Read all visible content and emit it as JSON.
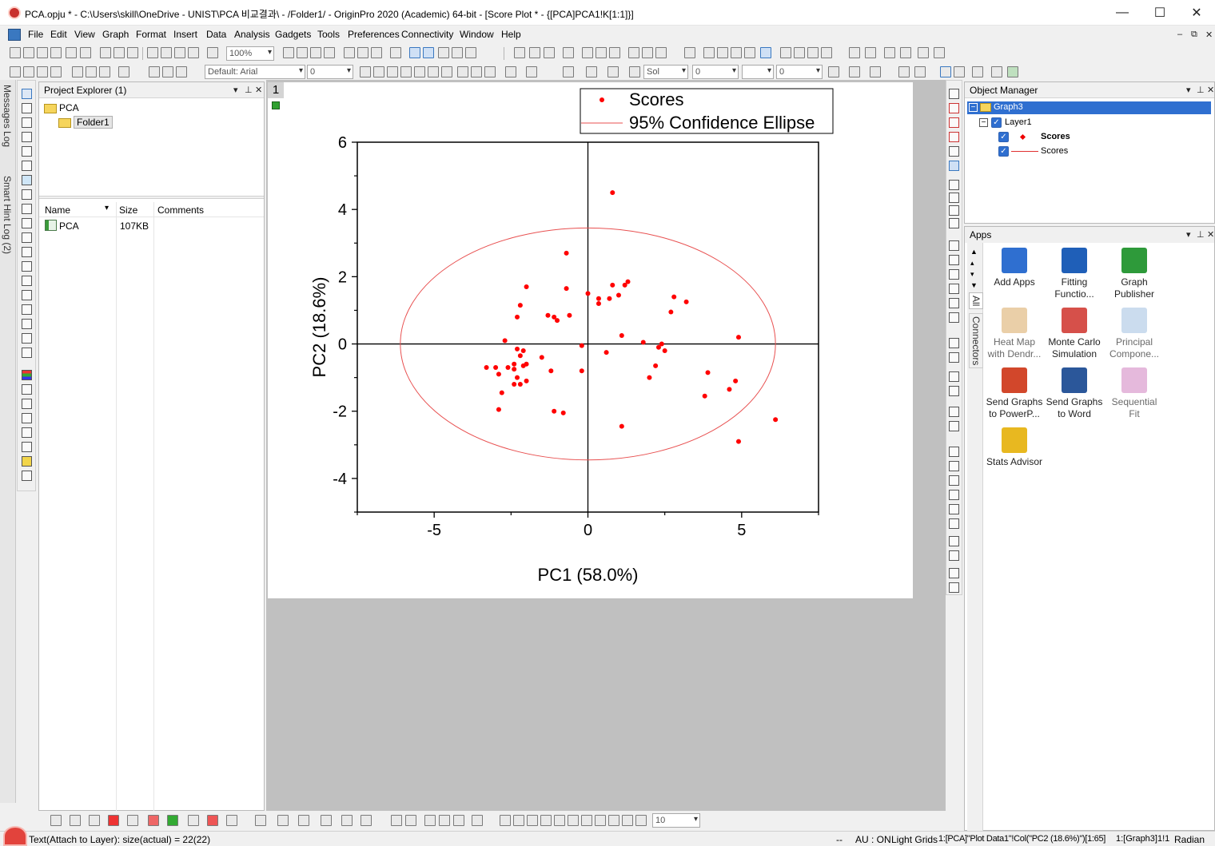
{
  "window": {
    "title": "PCA.opju * - C:\\Users\\skill\\OneDrive - UNIST\\PCA 비교결과\\ - /Folder1/ - OriginPro 2020 (Academic) 64-bit - [Score Plot * - {[PCA]PCA1!K[1:1]}]",
    "minimize": "—",
    "maximize": "☐",
    "close": "✕"
  },
  "menu": {
    "items": [
      "File",
      "Edit",
      "View",
      "Graph",
      "Format",
      "Insert",
      "Data",
      "Analysis",
      "Gadgets",
      "Tools",
      "Preferences",
      "Connectivity",
      "Window",
      "Help"
    ],
    "mdi_min": "–",
    "mdi_restore": "⧉",
    "mdi_close": "✕"
  },
  "toolbar": {
    "zoom": "100%",
    "font": "Default: Arial",
    "font_size": "0",
    "line_style": "Sol",
    "line_width": "0",
    "color_value": "0",
    "bottom_size": "10"
  },
  "side_tabs": {
    "messages_log": "Messages Log",
    "smart_hint_log": "Smart Hint Log (2)"
  },
  "project_explorer": {
    "title": "Project Explorer (1)",
    "root": "PCA",
    "folder": "Folder1",
    "columns": [
      "Name",
      "Size",
      "Comments"
    ],
    "files": [
      {
        "name": "PCA",
        "size": "107KB",
        "comments": ""
      }
    ]
  },
  "graph": {
    "layer_number": "1",
    "legend": [
      "Scores",
      "95% Confidence Ellipse"
    ]
  },
  "chart_data": {
    "type": "scatter",
    "title": "",
    "xlabel": "PC1 (58.0%)",
    "ylabel": "PC2 (18.6%)",
    "xlim": [
      -7.5,
      7.5
    ],
    "ylim": [
      -5,
      6
    ],
    "xticks": [
      -5,
      0,
      5
    ],
    "yticks": [
      -4,
      -2,
      0,
      2,
      4,
      6
    ],
    "grid": false,
    "legend_position": "top-right",
    "point_color": "#ff0000",
    "series": [
      {
        "name": "Scores",
        "x": [
          0.8,
          -0.7,
          -2.0,
          -0.7,
          1.0,
          1.3,
          0.8,
          0.7,
          1.2,
          0.0,
          0.35,
          0.35,
          2.8,
          3.2,
          2.7,
          -2.2,
          -2.3,
          -1.3,
          -1.1,
          -1.0,
          -0.6,
          1.1,
          1.8,
          2.3,
          2.4,
          2.5,
          -2.7,
          -2.3,
          -2.1,
          -2.2,
          -1.5,
          -2.1,
          -2.4,
          -2.0,
          -2.4,
          -2.6,
          -3.3,
          -3.0,
          -2.9,
          -1.2,
          -2.0,
          -2.3,
          -0.2,
          -2.2,
          -2.4,
          -2.8,
          -2.9,
          -1.1,
          -0.8,
          1.1,
          2.0,
          2.2,
          3.9,
          4.9,
          4.6,
          4.8,
          3.8,
          6.1,
          4.9,
          -0.2,
          0.6
        ],
        "y": [
          4.5,
          2.7,
          1.7,
          1.65,
          1.45,
          1.85,
          1.75,
          1.35,
          1.75,
          1.5,
          1.35,
          1.2,
          1.4,
          1.25,
          0.95,
          1.15,
          0.8,
          0.85,
          0.8,
          0.7,
          0.85,
          0.25,
          0.05,
          -0.1,
          0.0,
          -0.2,
          0.1,
          -0.15,
          -0.2,
          -0.35,
          -0.4,
          -0.65,
          -0.6,
          -0.6,
          -0.75,
          -0.7,
          -0.7,
          -0.7,
          -0.9,
          -0.8,
          -1.1,
          -1.0,
          -0.8,
          -1.2,
          -1.2,
          -1.45,
          -1.95,
          -2.0,
          -2.05,
          -2.45,
          -1.0,
          -0.65,
          -0.85,
          0.2,
          -1.35,
          -1.1,
          -1.55,
          -2.25,
          -2.9,
          -0.05,
          -0.25
        ]
      },
      {
        "name": "95% Confidence Ellipse",
        "type": "ellipse",
        "center": [
          0,
          0
        ],
        "semi_x": 6.1,
        "semi_y": 3.45,
        "color": "#e85050"
      }
    ]
  },
  "object_manager": {
    "title": "Object Manager",
    "graph": "Graph3",
    "layer": "Layer1",
    "plots": [
      "Scores",
      "Scores"
    ]
  },
  "apps": {
    "title": "Apps",
    "vertical_tabs": [
      "All",
      "Connectors"
    ],
    "items": [
      {
        "line1": "Add Apps",
        "line2": "",
        "icon": "add-apps-icon",
        "color": "#2f6fd0",
        "faded": false
      },
      {
        "line1": "Fitting",
        "line2": "Functio...",
        "icon": "fitting-function-icon",
        "color": "#1f5fb8",
        "faded": false
      },
      {
        "line1": "Graph",
        "line2": "Publisher",
        "icon": "graph-publisher-icon",
        "color": "#2e9a3a",
        "faded": false
      },
      {
        "line1": "Heat Map",
        "line2": "with Dendr...",
        "icon": "heat-map-icon",
        "color": "#d8a860",
        "faded": true
      },
      {
        "line1": "Monte Carlo",
        "line2": "Simulation",
        "icon": "monte-carlo-icon",
        "color": "#d6504a",
        "faded": false
      },
      {
        "line1": "Principal",
        "line2": "Compone...",
        "icon": "principal-component-icon",
        "color": "#a0c0e0",
        "faded": true
      },
      {
        "line1": "Send Graphs",
        "line2": "to PowerP...",
        "icon": "powerpoint-icon",
        "color": "#d2472b",
        "faded": false
      },
      {
        "line1": "Send Graphs",
        "line2": "to Word",
        "icon": "word-icon",
        "color": "#2b579a",
        "faded": false
      },
      {
        "line1": "Sequential",
        "line2": "Fit",
        "icon": "sequential-fit-icon",
        "color": "#d080c0",
        "faded": true
      },
      {
        "line1": "Stats Advisor",
        "line2": "",
        "icon": "stats-advisor-icon",
        "color": "#e8b820",
        "faded": false
      }
    ]
  },
  "status": {
    "left": "Text(Attach to Layer): size(actual) = 22(22)",
    "dashes": "--",
    "au": "AU : ON",
    "grids": "Light Grids",
    "plot_info": "1:[PCA]\"Plot Data1\"!Col(\"PC2 (18.6%)\")[1:65]",
    "graph_info": "1:[Graph3]1!1",
    "angle": "Radian"
  }
}
